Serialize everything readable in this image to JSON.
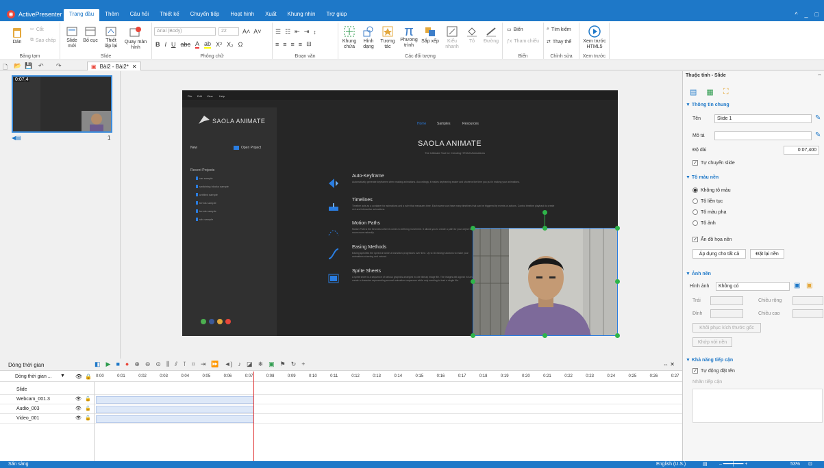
{
  "app": {
    "name": "ActivePresenter",
    "window_controls": [
      "^",
      "_",
      "□"
    ]
  },
  "tabs": [
    {
      "label": "Trang đầu",
      "active": true
    },
    {
      "label": "Thêm"
    },
    {
      "label": "Câu hỏi"
    },
    {
      "label": "Thiết kế"
    },
    {
      "label": "Chuyển tiếp"
    },
    {
      "label": "Hoạt hình"
    },
    {
      "label": "Xuất"
    },
    {
      "label": "Khung nhìn"
    },
    {
      "label": "Trợ giúp"
    }
  ],
  "ribbon": {
    "clipboard": {
      "label": "Bảng tạm",
      "paste": "Dán",
      "cut": "Cắt",
      "copy": "Sao chép"
    },
    "slide": {
      "label": "Slide",
      "new_slide": "Slide mới",
      "layout": "Bố cục",
      "design": "Thiết lập lại",
      "record": "Quay màn hình"
    },
    "font": {
      "label": "Phông chữ",
      "font_name": "Arial (Body)",
      "font_size": "22"
    },
    "paragraph": {
      "label": "Đoạn văn"
    },
    "objects": {
      "label": "Các đối tượng",
      "frame": "Khung chứa",
      "shape": "Hình dạng",
      "interact": "Tương tác",
      "equation": "Phương trình",
      "arrange": "Sắp xếp",
      "style": "Kiểu nhanh",
      "fill": "Tô",
      "line": "Đường"
    },
    "variables": {
      "label": "Biến",
      "variable": "Biến",
      "reference": "Tham chiếu"
    },
    "edit": {
      "label": "Chỉnh sửa",
      "find": "Tìm kiếm",
      "replace": "Thay thế"
    },
    "preview": {
      "label": "Xem trước",
      "html5": "Xem trước HTML5"
    }
  },
  "document_tab": {
    "label": "Bài2 - Bài2*"
  },
  "thumbnail": {
    "duration": "0:07,4",
    "index": "1"
  },
  "slide_content": {
    "title": "SAOLA ANIMATE",
    "subtitle": "The Ultimate Tool for Creating HTML5 Animations",
    "menu": [
      "File",
      "Edit",
      "View",
      "Help"
    ],
    "nav": [
      "Home",
      "Samples",
      "Resources"
    ],
    "sidebar_logo": "SAOLA ANIMATE",
    "new_label": "New",
    "open_label": "Open Project",
    "recent_label": "Recent Projects",
    "recent_items": [
      "car sample",
      "switching blocks sample",
      "untitled sample",
      "tennis sample",
      "tennis sample",
      "sdx sample"
    ],
    "features": [
      {
        "title": "Auto-Keyframe",
        "desc": "Automatically generate keyframes when making animations. Accordingly, it makes keyframing easier and shortens the time you put in making your animations."
      },
      {
        "title": "Timelines",
        "desc": "Timeline acts as a container for animations and a ruler that measures time. Each scene can have many timelines that can be triggered by events or actions. Control timeline playback to create rich and interactive animations."
      },
      {
        "title": "Motion Paths",
        "desc": "Motion Path is the best idea when it comes to defining movement. It allows you to create a path for your object to move more naturally."
      },
      {
        "title": "Easing Methods",
        "desc": "Easing specifies the speed at which a transition progresses over time. Up to 30 easing functions to make your animations stunning and natural."
      },
      {
        "title": "Sprite Sheets",
        "desc": "A sprite sheet is a sequence of various graphics arranged in one bitmap image file. The images will appear in turn to create a character representing several animation sequences while only needing to load a single file."
      }
    ]
  },
  "properties": {
    "panel_title": "Thuộc tính - Slide",
    "general": {
      "header": "Thông tin chung",
      "name_label": "Tên",
      "name_value": "Slide 1",
      "desc_label": "Mô tả",
      "desc_value": "",
      "duration_label": "Độ dài",
      "duration_value": "0:07,400",
      "auto_advance": "Tự chuyển slide"
    },
    "fill": {
      "header": "Tô màu nền",
      "options": [
        "Không tô màu",
        "Tô liền tục",
        "Tô màu pha",
        "Tô ảnh"
      ],
      "hide_bg": "Ẩn đồ họa nền",
      "apply_all": "Áp dụng cho tất cả",
      "reset_bg": "Đặt lại nền"
    },
    "bg_image": {
      "header": "Ảnh nền",
      "image_label": "Hình ảnh",
      "image_value": "Không có",
      "left": "Trái",
      "width": "Chiều rộng",
      "top": "Đỉnh",
      "height": "Chiều cao",
      "restore": "Khôi phục kích thước gốc",
      "fit": "Khớp với nền"
    },
    "accessibility": {
      "header": "Khả năng tiếp cận",
      "auto_name": "Tự động đặt tên",
      "label_placeholder": "Nhãn tiếp cận"
    }
  },
  "timeline": {
    "title": "Dòng thời gian",
    "column_header": "Dòng thời gian ...",
    "ticks": [
      "0:00",
      "0:01",
      "0:02",
      "0:03",
      "0:04",
      "0:05",
      "0:06",
      "0:07",
      "0:08",
      "0:09",
      "0:10",
      "0:11",
      "0:12",
      "0:13",
      "0:14",
      "0:15",
      "0:16",
      "0:17",
      "0:18",
      "0:19",
      "0:20",
      "0:21",
      "0:22",
      "0:23",
      "0:24",
      "0:25",
      "0:26",
      "0:27"
    ],
    "tracks": [
      "Slide",
      "Webcam_001.3",
      "Audio_003",
      "Video_001"
    ],
    "playhead_seconds": 7.4
  },
  "status": {
    "left": "Sẵn sàng",
    "language": "English (U.S.)",
    "zoom": "53%"
  },
  "colors": {
    "accent": "#1e78c8",
    "handle": "#2fb44a",
    "selection": "#2a7de1",
    "playhead": "#e03b3b"
  }
}
